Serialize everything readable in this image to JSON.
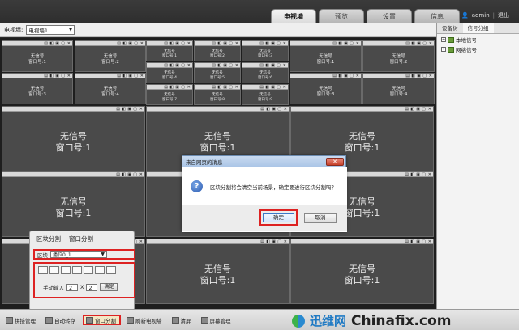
{
  "tabs": [
    "电视墙",
    "预览",
    "设置",
    "信息"
  ],
  "active_tab": 0,
  "user": {
    "name": "admin",
    "separator": "|",
    "logout": "退出"
  },
  "selbar": {
    "label": "电视墙:",
    "wall_value": "电视墙1"
  },
  "right_panel": {
    "tabs": [
      "设备树",
      "信号分组"
    ],
    "tree": [
      "本地信号",
      "网络信号"
    ]
  },
  "windows": {
    "small_label_a": "无信号",
    "top_left": [
      {
        "l1": "无信号",
        "l2": "窗口号:1"
      },
      {
        "l1": "无信号",
        "l2": "窗口号:2"
      },
      {
        "l1": "无信号",
        "l2": "窗口号:3"
      },
      {
        "l1": "无信号",
        "l2": "窗口号:4"
      }
    ],
    "top_mid": [
      {
        "l1": "无信号",
        "l2": "窗口号:1"
      },
      {
        "l1": "无信号",
        "l2": "窗口号:2"
      },
      {
        "l1": "无信号",
        "l2": "窗口号:3"
      },
      {
        "l1": "无信号",
        "l2": "窗口号:4"
      },
      {
        "l1": "无信号",
        "l2": "窗口号:5"
      },
      {
        "l1": "无信号",
        "l2": "窗口号:6"
      },
      {
        "l1": "无信号",
        "l2": "窗口号:7"
      },
      {
        "l1": "无信号",
        "l2": "窗口号:8"
      },
      {
        "l1": "无信号",
        "l2": "窗口号:9"
      }
    ],
    "top_right": [
      {
        "l1": "无信号",
        "l2": "窗口号:1"
      },
      {
        "l1": "无信号",
        "l2": "窗口号:2"
      },
      {
        "l1": "无信号",
        "l2": "窗口号:3"
      },
      {
        "l1": "无信号",
        "l2": "窗口号:4"
      }
    ],
    "big": {
      "l1": "无信号",
      "l2": "窗口号:1"
    }
  },
  "split_panel": {
    "tabs": [
      "区块分割",
      "窗口分割"
    ],
    "region_label": "区块",
    "region_value": "播位0_1",
    "manual_label": "手动输入",
    "rows": "2",
    "times": "X",
    "cols": "2",
    "confirm": "确定"
  },
  "dialog": {
    "title": "来自网页的消息",
    "close": "✕",
    "message": "区块分割将会清空当前场景，确定要进行区块分割吗？",
    "ok": "确定",
    "cancel": "取消"
  },
  "bottom_buttons": [
    "拼接管理",
    "自动转存",
    "窗口分割",
    "刷新电视墙",
    "清屏",
    "屏幕管理"
  ],
  "watermark": {
    "cn": "迅维网",
    "en": "Chinafix.com"
  }
}
